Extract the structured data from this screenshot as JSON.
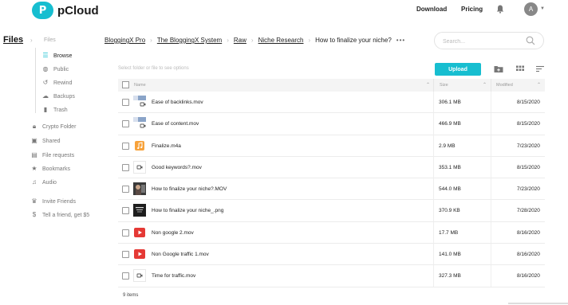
{
  "header": {
    "brand_letter": "P",
    "brand": "pCloud",
    "nav": [
      "Download",
      "Pricing"
    ],
    "avatar_letter": "A",
    "accent": "#17bed0"
  },
  "sidebar": {
    "title": "Files",
    "crumb": "Files",
    "tree": [
      {
        "label": "Browse",
        "icon": "list-icon",
        "active": true
      },
      {
        "label": "Public",
        "icon": "globe-icon"
      },
      {
        "label": "Rewind",
        "icon": "history-icon"
      },
      {
        "label": "Backups",
        "icon": "cloud-icon"
      },
      {
        "label": "Trash",
        "icon": "trash-icon"
      }
    ],
    "items": [
      {
        "label": "Crypto Folder",
        "icon": "lock-icon"
      },
      {
        "label": "Shared",
        "icon": "shared-folder-icon"
      },
      {
        "label": "File requests",
        "icon": "file-request-icon"
      },
      {
        "label": "Bookmarks",
        "icon": "star-icon"
      },
      {
        "label": "Audio",
        "icon": "headphones-icon"
      }
    ],
    "extras": [
      {
        "label": "Invite Friends",
        "icon": "trophy-icon"
      },
      {
        "label": "Tell a friend, get $5",
        "icon": "dollar-icon"
      }
    ]
  },
  "breadcrumb": {
    "items": [
      "BloggingX Pro",
      "The BloggingX System",
      "Raw",
      "Niche Research"
    ],
    "current": "How to finalize your niche?",
    "more": "•••"
  },
  "search": {
    "placeholder": "Search..."
  },
  "toolbar": {
    "hint": "Select folder or file to see options",
    "upload_label": "Upload"
  },
  "table": {
    "columns": [
      "Name",
      "Size",
      "Modified"
    ],
    "rows": [
      {
        "name": "Ease of backlinks.mov",
        "size": "306.1 MB",
        "modified": "8/15/2020",
        "thumb": "video-screen"
      },
      {
        "name": "Ease of content.mov",
        "size": "466.9 MB",
        "modified": "8/15/2020",
        "thumb": "video-screen"
      },
      {
        "name": "Finalize.m4a",
        "size": "2.9 MB",
        "modified": "7/23/2020",
        "thumb": "audio"
      },
      {
        "name": "Good keywords?.mov",
        "size": "353.1 MB",
        "modified": "8/15/2020",
        "thumb": "video"
      },
      {
        "name": "How to finalize your niche?.MOV",
        "size": "544.0 MB",
        "modified": "7/23/2020",
        "thumb": "photo"
      },
      {
        "name": "How to finalize your niche_.png",
        "size": "370.9 KB",
        "modified": "7/28/2020",
        "thumb": "image"
      },
      {
        "name": "Non google 2.mov",
        "size": "17.7 MB",
        "modified": "8/16/2020",
        "thumb": "youtube"
      },
      {
        "name": "Non Google traffic 1.mov",
        "size": "141.0 MB",
        "modified": "8/16/2020",
        "thumb": "youtube"
      },
      {
        "name": "Time for traffic.mov",
        "size": "327.3 MB",
        "modified": "8/16/2020",
        "thumb": "video"
      }
    ]
  },
  "footer": {
    "count": "9 items"
  }
}
